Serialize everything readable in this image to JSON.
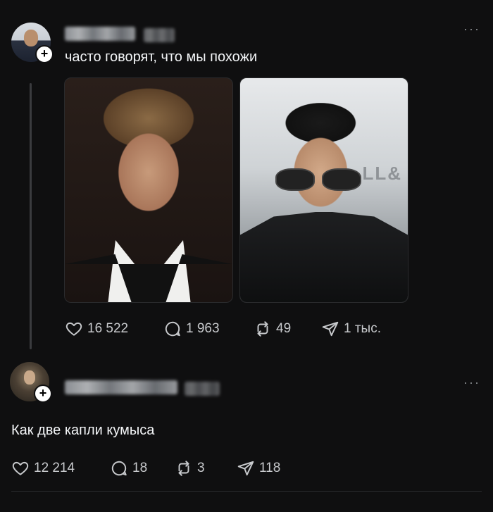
{
  "post_1": {
    "username": "",
    "text": "часто говорят, что мы похожи",
    "images": [
      {
        "description_icon": "photo-actor-icon"
      },
      {
        "description_icon": "photo-selfie-icon",
        "sign_text": "LL&"
      }
    ],
    "stats": {
      "likes": "16 522",
      "replies": "1 963",
      "reposts": "49",
      "shares": "1 тыс."
    }
  },
  "post_2": {
    "username": "",
    "text": "Как две капли кумыса",
    "stats": {
      "likes": "12 214",
      "replies": "18",
      "reposts": "3",
      "shares": "118"
    }
  },
  "ui": {
    "more_label": "···",
    "follow_label": "+"
  },
  "colors": {
    "background": "#0f0f10",
    "text": "#f3f5f7",
    "muted": "#c8cacd",
    "thread_line": "#3a3b3e"
  }
}
